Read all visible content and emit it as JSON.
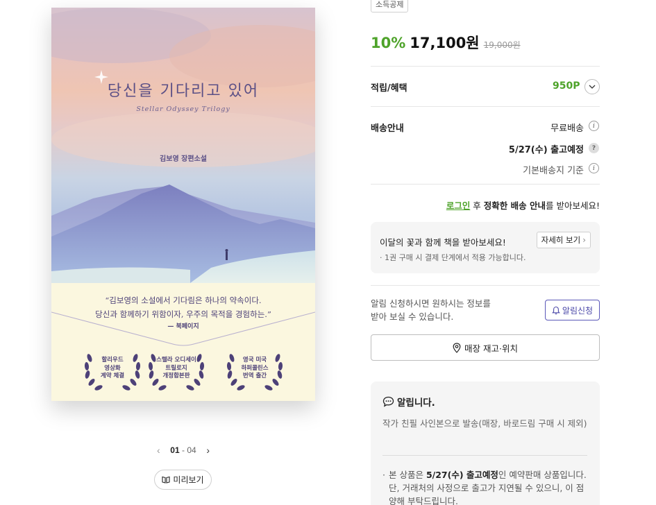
{
  "book": {
    "cover_title": "당신을 기다리고 있어",
    "cover_subtitle": "Stellar Odyssey Trilogy",
    "cover_author": "김보영 장편소설",
    "cover_quote_line1": "“김보영의 소설에서 기다림은 하나의 약속이다.",
    "cover_quote_line2": "당신과 함께하기 위함이자, 우주의 목적을 경험하는.”",
    "cover_quote_source": "— 북페이지",
    "laurels": [
      {
        "l1": "할리우드",
        "l2": "영상화",
        "l3": "계약 체결"
      },
      {
        "l1": "스텔라 오디세이",
        "l2": "트릴로지",
        "l3": "개정합본판"
      },
      {
        "l1": "영국 미국",
        "l2": "하퍼콜린스",
        "l3": "번역 출간"
      }
    ]
  },
  "pager": {
    "current": "01",
    "separator": " - ",
    "total": "04"
  },
  "preview_button": "미리보기",
  "tag": "소득공제",
  "price": {
    "discount": "10%",
    "final": "17,100원",
    "original": "19,000원"
  },
  "points": {
    "label": "적립/혜택",
    "value": "950P"
  },
  "shipping": {
    "label": "배송안내",
    "type": "무료배송",
    "date": "5/27(수) 출고예정",
    "base": "기본배송지 기준"
  },
  "login_notice": {
    "link": "로그인",
    "middle": " 후 ",
    "bold": "정확한 배송 안내",
    "end": "를 받아보세요!"
  },
  "flower": {
    "title": "이달의 꽃과 함께 책을 받아보세요!",
    "note": "· 1권 구매 시 결제 단계에서 적용 가능합니다.",
    "button": "자세히 보기"
  },
  "alert": {
    "line1": "알림 신청하시면 원하시는 정보를",
    "line2": "받아 보실 수 있습니다.",
    "button": "알림신청"
  },
  "store_button": "매장 재고·위치",
  "notice": {
    "title": "알립니다.",
    "body": "작가 친필 사인본으로 발송(매장, 바로드림 구매 시 제외)",
    "bullet_pre": "본 상품은 ",
    "bullet_bold": "5/27(수) 출고예정",
    "bullet_post": "인 예약판매 상품입니다. 단, 거래처의 사정으로 출고가 지연될 수 있으니, 이 점 양해 부탁드립니다."
  },
  "colors": {
    "accent_green": "#4ea32a",
    "alert_purple": "#4a47a8",
    "cover_band": "#fbf7df"
  }
}
